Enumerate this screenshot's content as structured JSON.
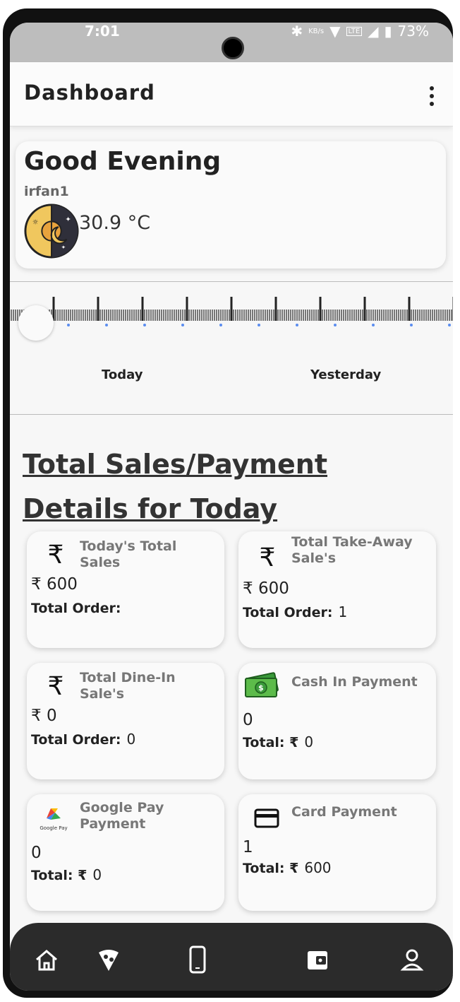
{
  "status_bar": {
    "time": "7:01",
    "net_speed": "KB/s",
    "network": "LTE",
    "battery": "73%"
  },
  "app_bar": {
    "title": "Dashboard",
    "menu_icon": "more-vert-icon"
  },
  "greeting": {
    "title": "Good Evening",
    "user": "irfan1",
    "temperature": "30.9 °C",
    "weather_icon": "day-night-icon"
  },
  "day_selector": {
    "labels": [
      "Today",
      "Yesterday"
    ]
  },
  "section": {
    "title": "Total Sales/Payment Details for Today"
  },
  "tiles": [
    {
      "icon": "rupee-icon",
      "title": "Today's Total Sales",
      "amount": "₹ 600",
      "sub_label": "Total Order:",
      "sub_value": ""
    },
    {
      "icon": "rupee-icon",
      "title": "Total Take-Away Sale's",
      "amount": "₹ 600",
      "sub_label": "Total Order:",
      "sub_value": "1"
    },
    {
      "icon": "rupee-icon",
      "title": "Total Dine-In Sale's",
      "amount": "₹ 0",
      "sub_label": "Total Order:",
      "sub_value": "0"
    },
    {
      "icon": "cash-icon",
      "title": "Cash In Payment",
      "amount": "0",
      "sub_label": "Total: ₹",
      "sub_value": "0"
    },
    {
      "icon": "google-pay-icon",
      "icon_text": "Google Pay",
      "title": "Google Pay Payment",
      "amount": "0",
      "sub_label": "Total: ₹",
      "sub_value": "0"
    },
    {
      "icon": "card-icon",
      "title": "Card Payment",
      "amount": "1",
      "sub_label": "Total: ₹",
      "sub_value": "600"
    }
  ],
  "bottom_nav": [
    "home-icon",
    "pizza-icon",
    "phone-icon",
    "wallet-icon",
    "person-icon"
  ]
}
